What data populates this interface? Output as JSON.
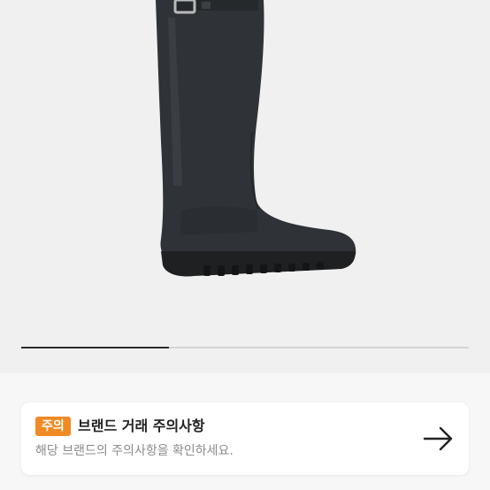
{
  "gallery": {
    "image_subject": "rubber rain boot",
    "page_progress": 0.33,
    "colors": {
      "boot": "#2f3236",
      "sole": "#1e2022",
      "buckle": "#b9b9b9",
      "indicator": "#2b2b2b",
      "track": "#d4d4d4"
    }
  },
  "notice": {
    "tag_label": "주의",
    "title": "브랜드 거래 주의사항",
    "description": "해당 브랜드의 주의사항을 확인하세요.",
    "arrow_icon": "arrow-right-icon",
    "colors": {
      "tag_bg": "#f08a24",
      "title": "#222222",
      "description": "#8a8a8a"
    }
  }
}
